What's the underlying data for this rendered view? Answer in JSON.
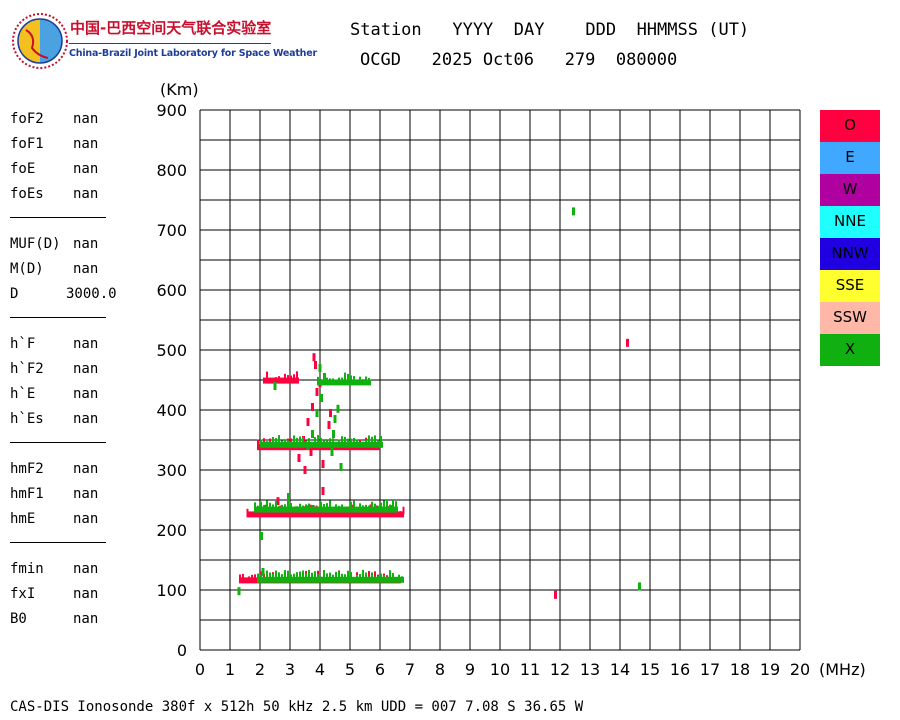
{
  "logo": {
    "title_cn": "中国-巴西空间天气联合实验室",
    "title_en": "China-Brazil Joint Laboratory for Space Weather"
  },
  "header": {
    "line1": "Station   YYYY  DAY    DDD  HHMMSS (UT)",
    "line2": "OCGD   2025 Oct06   279  080000"
  },
  "params": [
    {
      "group": 1,
      "label": "foF2",
      "value": "nan"
    },
    {
      "group": 1,
      "label": "foF1",
      "value": "nan"
    },
    {
      "group": 1,
      "label": "foE",
      "value": "nan"
    },
    {
      "group": 1,
      "label": "foEs",
      "value": "nan"
    },
    {
      "group": 2,
      "label": "MUF(D)",
      "value": "nan"
    },
    {
      "group": 2,
      "label": "M(D)",
      "value": "nan"
    },
    {
      "group": 2,
      "label": "D",
      "value": "3000.0"
    },
    {
      "group": 3,
      "label": "h`F",
      "value": "nan"
    },
    {
      "group": 3,
      "label": "h`F2",
      "value": "nan"
    },
    {
      "group": 3,
      "label": "h`E",
      "value": "nan"
    },
    {
      "group": 3,
      "label": "h`Es",
      "value": "nan"
    },
    {
      "group": 4,
      "label": "hmF2",
      "value": "nan"
    },
    {
      "group": 4,
      "label": "hmF1",
      "value": "nan"
    },
    {
      "group": 4,
      "label": "hmE",
      "value": "nan"
    },
    {
      "group": 5,
      "label": "fmin",
      "value": "nan"
    },
    {
      "group": 5,
      "label": "fxI",
      "value": "nan"
    },
    {
      "group": 5,
      "label": "B0",
      "value": "nan"
    }
  ],
  "legend": [
    {
      "label": "O",
      "color": "#ff0040"
    },
    {
      "label": "E",
      "color": "#40a8ff"
    },
    {
      "label": "W",
      "color": "#b000a0"
    },
    {
      "label": "NNE",
      "color": "#20ffff"
    },
    {
      "label": "NNW",
      "color": "#2000e0"
    },
    {
      "label": "SSE",
      "color": "#ffff30"
    },
    {
      "label": "SSW",
      "color": "#ffb8a8"
    },
    {
      "label": "X",
      "color": "#10b010"
    }
  ],
  "footer": "CAS-DIS Ionosonde 380f x 512h 50 kHz 2.5 km UDD = 007 7.08 S 36.65 W",
  "chart_data": {
    "type": "scatter",
    "title": "",
    "xlabel": "(MHz)",
    "ylabel": "(Km)",
    "xlim": [
      0,
      20
    ],
    "ylim": [
      0,
      900
    ],
    "x_ticks": [
      0,
      1,
      2,
      3,
      4,
      5,
      6,
      7,
      8,
      9,
      10,
      11,
      12,
      13,
      14,
      15,
      16,
      17,
      18,
      19,
      20
    ],
    "y_ticks": [
      0,
      100,
      200,
      300,
      400,
      500,
      600,
      700,
      800,
      900
    ],
    "grid": true,
    "legend_position": "right",
    "series": [
      {
        "name": "O",
        "color": "#ff0040",
        "segments": [
          {
            "x": [
              1.3,
              6.7
            ],
            "y": 116
          },
          {
            "x": [
              1.55,
              6.8
            ],
            "y": 226
          },
          {
            "x": [
              1.9,
              6.0
            ],
            "y": 338
          },
          {
            "x": [
              2.1,
              3.3
            ],
            "y": 449
          }
        ],
        "points": [
          {
            "x": 3.3,
            "y": 320
          },
          {
            "x": 3.45,
            "y": 350
          },
          {
            "x": 3.6,
            "y": 380
          },
          {
            "x": 3.75,
            "y": 405
          },
          {
            "x": 3.9,
            "y": 430
          },
          {
            "x": 4.0,
            "y": 445
          },
          {
            "x": 3.85,
            "y": 475
          },
          {
            "x": 3.8,
            "y": 488
          },
          {
            "x": 4.1,
            "y": 310
          },
          {
            "x": 4.2,
            "y": 340
          },
          {
            "x": 4.3,
            "y": 375
          },
          {
            "x": 4.35,
            "y": 395
          },
          {
            "x": 3.5,
            "y": 300
          },
          {
            "x": 3.7,
            "y": 330
          },
          {
            "x": 2.6,
            "y": 248
          },
          {
            "x": 4.1,
            "y": 265
          },
          {
            "x": 11.85,
            "y": 92
          },
          {
            "x": 14.25,
            "y": 512
          }
        ]
      },
      {
        "name": "X",
        "color": "#10b010",
        "segments": [
          {
            "x": [
              1.9,
              6.8
            ],
            "y": 117
          },
          {
            "x": [
              1.8,
              6.6
            ],
            "y": 234
          },
          {
            "x": [
              2.0,
              6.1
            ],
            "y": 342
          },
          {
            "x": [
              3.9,
              5.7
            ],
            "y": 446
          }
        ],
        "points": [
          {
            "x": 1.3,
            "y": 98
          },
          {
            "x": 2.05,
            "y": 190
          },
          {
            "x": 2.1,
            "y": 130
          },
          {
            "x": 3.6,
            "y": 340
          },
          {
            "x": 3.75,
            "y": 360
          },
          {
            "x": 3.9,
            "y": 395
          },
          {
            "x": 4.05,
            "y": 420
          },
          {
            "x": 4.15,
            "y": 455
          },
          {
            "x": 4.0,
            "y": 470
          },
          {
            "x": 4.4,
            "y": 330
          },
          {
            "x": 4.45,
            "y": 360
          },
          {
            "x": 4.5,
            "y": 385
          },
          {
            "x": 4.7,
            "y": 305
          },
          {
            "x": 4.6,
            "y": 402
          },
          {
            "x": 2.5,
            "y": 440
          },
          {
            "x": 2.95,
            "y": 255
          },
          {
            "x": 12.45,
            "y": 731
          },
          {
            "x": 14.65,
            "y": 106
          }
        ]
      }
    ]
  }
}
